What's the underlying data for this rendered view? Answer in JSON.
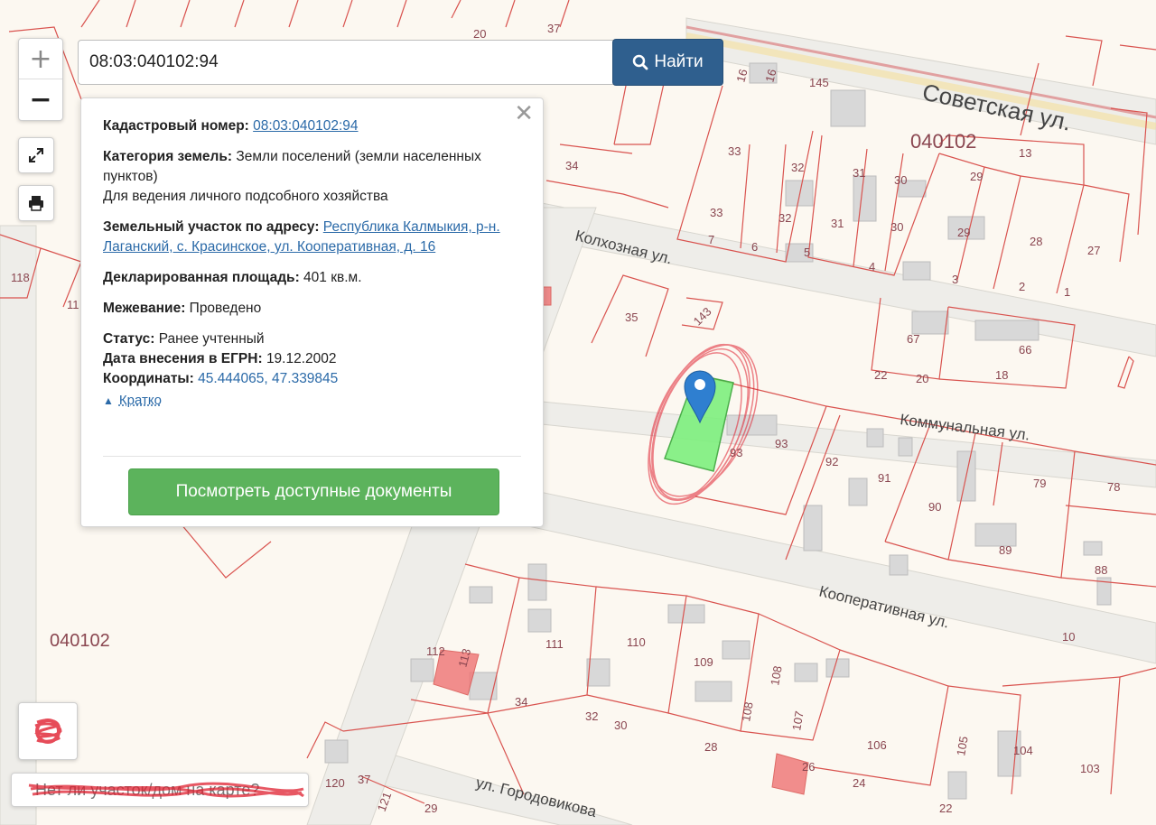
{
  "search": {
    "value": "08:03:040102:94",
    "button_label": "Найти"
  },
  "zoom": {
    "plus": "+",
    "minus": "−"
  },
  "info_card": {
    "cadastral_label": "Кадастровый номер:",
    "cadastral_value": "08:03:040102:94",
    "category_label": "Категория земель:",
    "category_value": "Земли поселений (земли населенных пунктов)",
    "use_value": "Для ведения личного подсобного хозяйства",
    "address_label": "Земельный участок по адресу:",
    "address_value": "Республика Калмыкия, р-н. Лаганский, с. Красинское, ул. Кооперативная, д. 16",
    "area_label": "Декларированная площадь:",
    "area_value": "401 кв.м.",
    "survey_label": "Межевание:",
    "survey_value": "Проведено",
    "status_label": "Статус:",
    "status_value": "Ранее учтенный",
    "egrn_label": "Дата внесения в ЕГРН:",
    "egrn_value": "19.12.2002",
    "coords_label": "Координаты:",
    "coords_value": "45.444065, 47.339845",
    "collapse_label": "Кратко",
    "docs_button": "Посмотреть доступные документы"
  },
  "bottom_bar": {
    "text": "Нет ли участок/дом на карте?"
  },
  "map": {
    "quarter_top": "040102",
    "quarter_left": "040102",
    "streets": {
      "sovetskaya": "Советская ул.",
      "kolkhoznaya": "Колхозная ул.",
      "kommunalnaya": "Коммунальная ул.",
      "kooperativnaya": "Кооперативная ул.",
      "gorodovikova": "ул. Городовикова"
    },
    "labels": [
      "16",
      "16",
      "145",
      "20",
      "37",
      "33",
      "32",
      "31",
      "30",
      "29",
      "13",
      "34",
      "33",
      "32",
      "31",
      "30",
      "29",
      "28",
      "27",
      "7",
      "6",
      "5",
      "4",
      "3",
      "2",
      "1",
      "118",
      "11",
      "35",
      "143",
      "67",
      "66",
      "22",
      "20",
      "18",
      "93",
      "93",
      "92",
      "91",
      "90",
      "79",
      "78",
      "89",
      "88",
      "10",
      "111",
      "110",
      "112",
      "113",
      "109",
      "108",
      "108",
      "107",
      "106",
      "105",
      "104",
      "103",
      "34",
      "32",
      "30",
      "28",
      "26",
      "24",
      "22",
      "120",
      "37",
      "121",
      "29"
    ]
  },
  "colors": {
    "parcel_line": "#d9534f",
    "selected_parcel": "#7ef07e",
    "marker": "#2f7fd0",
    "search_button": "#2f5f8e",
    "docs_button": "#5cb35c",
    "road": "#eeeeea"
  }
}
